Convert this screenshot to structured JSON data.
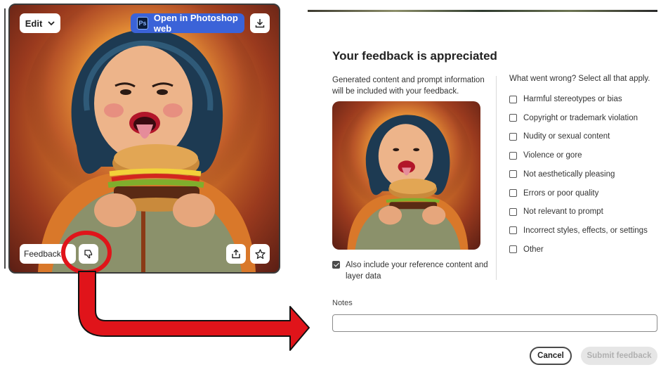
{
  "image_card": {
    "edit_label": "Edit",
    "open_photoshop_label": "Open in Photoshop web",
    "photoshop_logo": "Ps",
    "feedback_label": "Feedback",
    "icons": [
      "chevron-down-icon",
      "download-icon",
      "thumbs-down-icon",
      "share-icon",
      "star-icon"
    ]
  },
  "dialog": {
    "title": "Your feedback is appreciated",
    "intro": "Generated content and prompt information will be included with your feedback.",
    "include_reference_label": "Also include your reference content and layer data",
    "include_reference_checked": true,
    "question": "What went wrong? Select all that apply.",
    "options": [
      {
        "label": "Harmful stereotypes or bias",
        "checked": false
      },
      {
        "label": "Copyright or trademark violation",
        "checked": false
      },
      {
        "label": "Nudity or sexual content",
        "checked": false
      },
      {
        "label": "Violence or gore",
        "checked": false
      },
      {
        "label": "Not aesthetically pleasing",
        "checked": false
      },
      {
        "label": "Errors or poor quality",
        "checked": false
      },
      {
        "label": "Not relevant to prompt",
        "checked": false
      },
      {
        "label": "Incorrect styles, effects, or settings",
        "checked": false
      },
      {
        "label": "Other",
        "checked": false
      }
    ],
    "notes_label": "Notes",
    "notes_value": "",
    "cancel_label": "Cancel",
    "submit_label": "Submit feedback"
  },
  "colors": {
    "photoshop_button": "#3b63d8",
    "annotation": "#e0141a"
  }
}
